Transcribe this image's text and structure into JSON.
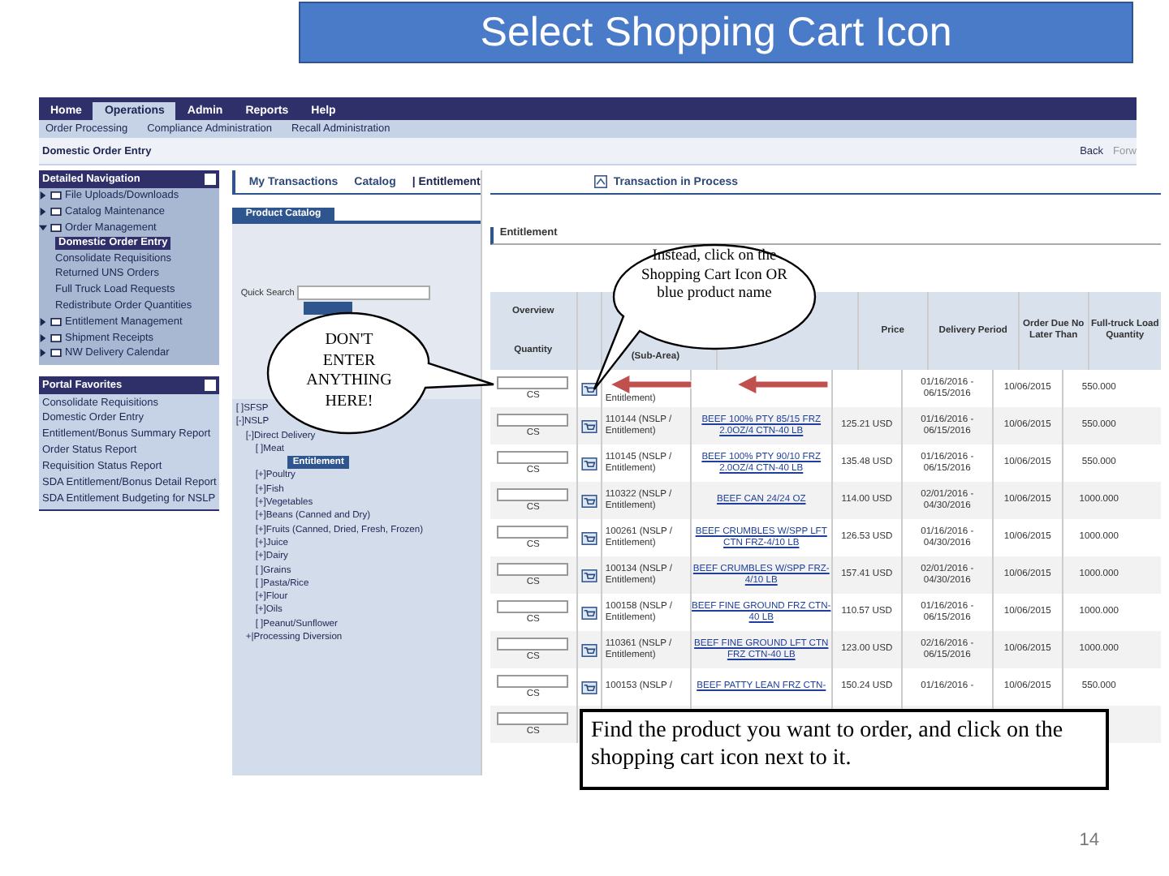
{
  "slide_title": "Select Shopping Cart Icon",
  "menu": [
    {
      "label": "Home",
      "selected": false
    },
    {
      "label": "Operations",
      "selected": true
    },
    {
      "label": "Admin",
      "selected": false
    },
    {
      "label": "Reports",
      "selected": false
    },
    {
      "label": "Help",
      "selected": false
    }
  ],
  "submenu": [
    "Order Processing",
    "Compliance Administration",
    "Recall Administration"
  ],
  "breadcrumb": "Domestic Order Entry",
  "history": [
    "Back",
    "Forw"
  ],
  "nav": {
    "title": "Detailed Navigation",
    "items": [
      {
        "label": "File Uploads/Downloads",
        "expanded": false
      },
      {
        "label": "Catalog Maintenance",
        "expanded": false
      },
      {
        "label": "Order Management",
        "expanded": true,
        "children": [
          {
            "label": "Domestic Order Entry",
            "selected": true
          },
          {
            "label": "Consolidate Requisitions",
            "selected": false
          },
          {
            "label": "Returned UNS Orders",
            "selected": false
          },
          {
            "label": "Full Truck Load Requests",
            "selected": false
          },
          {
            "label": "Redistribute Order Quantities",
            "selected": false
          }
        ]
      },
      {
        "label": "Entitlement Management",
        "expanded": false
      },
      {
        "label": "Shipment Receipts",
        "expanded": false
      },
      {
        "label": "NW Delivery Calendar",
        "expanded": false
      }
    ]
  },
  "favorites": {
    "title": "Portal Favorites",
    "items": [
      "Consolidate Requisitions",
      "Domestic Order Entry",
      "Entitlement/Bonus Summary Report",
      "Order Status Report",
      "Requisition Status Report",
      "SDA Entitlement/Bonus Detail Report",
      "SDA Entitlement Budgeting for NSLP"
    ]
  },
  "tabs": [
    {
      "label": "My Transactions",
      "selected": false
    },
    {
      "label": "Catalog",
      "selected": false
    },
    {
      "label": "| Entitlement",
      "selected": true
    }
  ],
  "process_tab": "Transaction in Process",
  "catalog_tab": "Product Catalog",
  "quick_search": {
    "label": "Quick Search"
  },
  "tree": [
    {
      "label": "[ ]SFSP",
      "selected": false
    },
    {
      "label": "[-]NSLP",
      "selected": false,
      "children": [
        {
          "label": "[-]Direct Delivery",
          "selected": false,
          "children": [
            {
              "label": "[ ]Meat",
              "selected": false,
              "children": [
                {
                  "label": "Entitlement",
                  "selected": true
                }
              ]
            },
            {
              "label": "[+]Poultry",
              "selected": false
            },
            {
              "label": "[+]Fish",
              "selected": false
            },
            {
              "label": "[+]Vegetables",
              "selected": false
            },
            {
              "label": "[+]Beans (Canned and Dry)",
              "selected": false
            },
            {
              "label": "[+]Fruits (Canned, Dried, Fresh, Frozen)",
              "selected": false
            },
            {
              "label": "[+]Juice",
              "selected": false
            },
            {
              "label": "[+]Dairy",
              "selected": false
            },
            {
              "label": "[ ]Grains",
              "selected": false
            },
            {
              "label": "[ ]Pasta/Rice",
              "selected": false
            },
            {
              "label": "[+]Flour",
              "selected": false
            },
            {
              "label": "[+]Oils",
              "selected": false
            },
            {
              "label": "[ ]Peanut/Sunflower",
              "selected": false
            }
          ]
        },
        {
          "label": "+|Processing Diversion",
          "selected": false
        }
      ]
    }
  ],
  "section_title": "Entitlement",
  "table": {
    "columns": [
      "Overview",
      "Quantity",
      "(Sub-Area)",
      "Price",
      "Delivery Period",
      "Order Due No Later Than",
      "Full-truck Load Quantity"
    ],
    "rows": [
      {
        "unit": "CS",
        "material": "Entitlement)",
        "delivery": "01/16/2016 - 06/15/2016",
        "due": "10/06/2015",
        "ftl": "550.000"
      },
      {
        "unit": "CS",
        "material": "110144 (NSLP / Entitlement)",
        "product": "BEEF 100% PTY 85/15 FRZ 2.0OZ/4 CTN-40 LB",
        "price": "125.21 USD",
        "delivery": "01/16/2016 - 06/15/2016",
        "due": "10/06/2015",
        "ftl": "550.000"
      },
      {
        "unit": "CS",
        "material": "110145 (NSLP / Entitlement)",
        "product": "BEEF 100% PTY 90/10 FRZ 2.0OZ/4 CTN-40 LB",
        "price": "135.48 USD",
        "delivery": "01/16/2016 - 06/15/2016",
        "due": "10/06/2015",
        "ftl": "550.000"
      },
      {
        "unit": "CS",
        "material": "110322 (NSLP / Entitlement)",
        "product": "BEEF CAN 24/24 OZ",
        "price": "114.00 USD",
        "delivery": "02/01/2016 - 04/30/2016",
        "due": "10/06/2015",
        "ftl": "1000.000"
      },
      {
        "unit": "CS",
        "material": "100261 (NSLP / Entitlement)",
        "product": "BEEF CRUMBLES W/SPP LFT CTN FRZ-4/10 LB",
        "price": "126.53 USD",
        "delivery": "01/16/2016 - 04/30/2016",
        "due": "10/06/2015",
        "ftl": "1000.000"
      },
      {
        "unit": "CS",
        "material": "100134 (NSLP / Entitlement)",
        "product": "BEEF CRUMBLES W/SPP FRZ-4/10 LB",
        "price": "157.41 USD",
        "delivery": "02/01/2016 - 04/30/2016",
        "due": "10/06/2015",
        "ftl": "1000.000"
      },
      {
        "unit": "CS",
        "material": "100158 (NSLP / Entitlement)",
        "product": "BEEF FINE GROUND FRZ CTN-40 LB",
        "price": "110.57 USD",
        "delivery": "01/16/2016 - 06/15/2016",
        "due": "10/06/2015",
        "ftl": "1000.000"
      },
      {
        "unit": "CS",
        "material": "110361 (NSLP / Entitlement)",
        "product": "BEEF FINE GROUND LFT CTN FRZ CTN-40 LB",
        "price": "123.00 USD",
        "delivery": "02/16/2016 - 06/15/2016",
        "due": "10/06/2015",
        "ftl": "1000.000"
      },
      {
        "unit": "CS",
        "material": "100153 (NSLP /",
        "product": "BEEF PATTY LEAN FRZ CTN-",
        "price": "150.24 USD",
        "delivery": "01/16/2016 -",
        "due": "10/06/2015",
        "ftl": "550.000"
      },
      {
        "unit": "CS"
      }
    ]
  },
  "callouts": [
    "DON'T ENTER ANYTHING HERE!",
    "Instead, click on the Shopping Cart Icon OR blue product name"
  ],
  "note": "Find the product you want to order, and click on the shopping cart icon next to it.",
  "page_number": "14"
}
